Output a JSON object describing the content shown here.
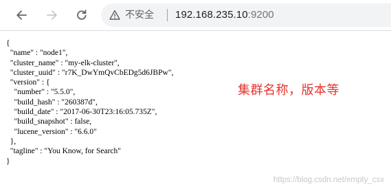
{
  "browser": {
    "insecure_label": "不安全",
    "url_host": "192.168.235.10",
    "url_port": ":9200"
  },
  "json_lines": [
    "{",
    "  \"name\" : \"node1\",",
    "  \"cluster_name\" : \"my-elk-cluster\",",
    "  \"cluster_uuid\" : \"r7K_DwYmQvCbEDg5d6JBPw\",",
    "  \"version\" : {",
    "    \"number\" : \"5.5.0\",",
    "    \"build_hash\" : \"260387d\",",
    "    \"build_date\" : \"2017-06-30T23:16:05.735Z\",",
    "    \"build_snapshot\" : false,",
    "    \"lucene_version\" : \"6.6.0\"",
    "  },",
    "  \"tagline\" : \"You Know, for Search\"",
    "}"
  ],
  "annotation": {
    "text": "集群名称，版本等",
    "color": "#e8332d"
  },
  "watermark": "https://blog.csdn.net/empty_csx"
}
